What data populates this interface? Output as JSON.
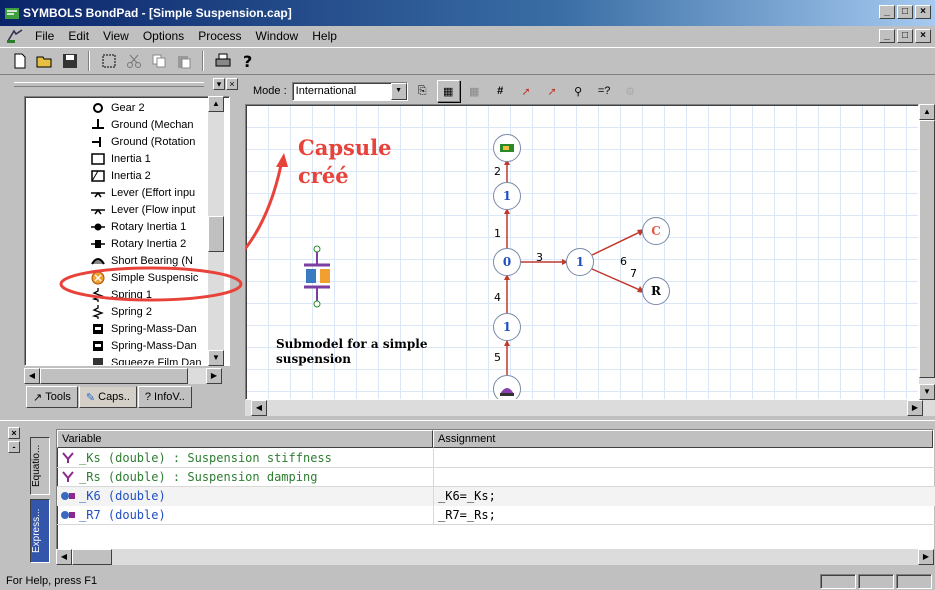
{
  "window": {
    "title": "SYMBOLS BondPad - [Simple Suspension.cap]",
    "controls": [
      "_",
      "□",
      "×"
    ]
  },
  "menu": {
    "items": [
      "File",
      "Edit",
      "View",
      "Options",
      "Process",
      "Window",
      "Help"
    ]
  },
  "toolbar": {
    "buttons": [
      "new-icon",
      "open-icon",
      "save-icon",
      "select-icon",
      "cut-icon",
      "copy-icon",
      "paste-icon",
      "print-icon",
      "help-icon"
    ]
  },
  "tree": {
    "items": [
      {
        "label": "Gear 2"
      },
      {
        "label": "Ground (Mechan"
      },
      {
        "label": "Ground (Rotation"
      },
      {
        "label": "Inertia 1"
      },
      {
        "label": "Inertia 2"
      },
      {
        "label": "Lever (Effort inpu"
      },
      {
        "label": "Lever (Flow input"
      },
      {
        "label": "Rotary Inertia 1"
      },
      {
        "label": "Rotary Inertia 2"
      },
      {
        "label": "Short Bearing (N"
      },
      {
        "label": "Simple Suspensic"
      },
      {
        "label": "Spring 1"
      },
      {
        "label": "Spring 2"
      },
      {
        "label": "Spring-Mass-Dan"
      },
      {
        "label": "Spring-Mass-Dan"
      },
      {
        "label": "Squeeze Film Dan"
      }
    ],
    "tabs": [
      "Tools",
      "Caps..",
      "InfoV.."
    ]
  },
  "diagram": {
    "mode_label": "Mode :",
    "mode_value": "International",
    "annotation_line1": "Capsule",
    "annotation_line2": "créé",
    "caption_line1": "Submodel for a simple",
    "caption_line2": "suspension",
    "nodes": {
      "n1a": "1",
      "n1b": "1",
      "n0": "0",
      "n1c": "1",
      "c": "C",
      "r": "R"
    },
    "bond_labels": [
      "2",
      "1",
      "3",
      "4",
      "5",
      "6",
      "7"
    ]
  },
  "variables": {
    "headers": [
      "Variable",
      "Assignment"
    ],
    "side_tabs": [
      "Equatio...",
      "Express..."
    ],
    "rows": [
      {
        "variable": "_Ks (double) : Suspension stiffness",
        "assignment": ""
      },
      {
        "variable": "_Rs (double) : Suspension damping",
        "assignment": ""
      },
      {
        "variable": "_K6 (double)",
        "assignment": "_K6=_Ks;"
      },
      {
        "variable": "_R7 (double)",
        "assignment": "_R7=_Rs;"
      }
    ]
  },
  "status": {
    "text": "For Help, press F1"
  },
  "colors": {
    "annotation_red": "#e8433a",
    "bond_arrow_red": "#c0392b",
    "node_blue": "#1f4fc2",
    "comment_green": "#2e7d32"
  }
}
